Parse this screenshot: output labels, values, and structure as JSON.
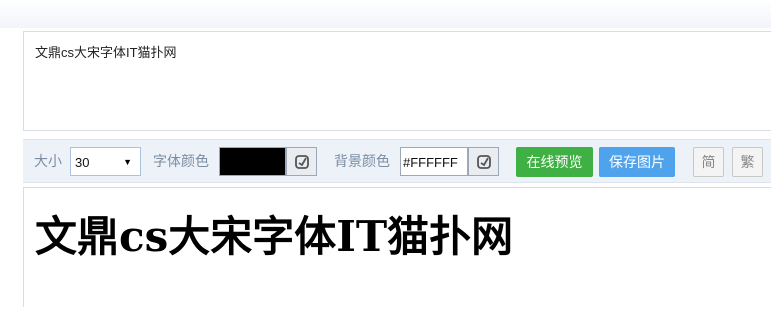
{
  "input": {
    "text": "文鼎cs大宋字体IT猫扑网"
  },
  "toolbar": {
    "size_label": "大小",
    "size_value": "30",
    "font_color_label": "字体颜色",
    "font_color_value": "#000000",
    "bg_color_label": "背景颜色",
    "bg_color_value": "#FFFFFF",
    "preview_button": "在线预览",
    "save_button": "保存图片",
    "simplified_button": "简",
    "traditional_button": "繁"
  },
  "preview": {
    "text": "文鼎cs大宋字体IT猫扑网"
  },
  "colors": {
    "preview_button_bg": "#3fb043",
    "save_button_bg": "#4ea3ec",
    "toolbar_bg": "#edf2f9"
  },
  "icons": {
    "picker": "color-picker-icon",
    "dropdown": "dropdown-arrow-icon"
  }
}
